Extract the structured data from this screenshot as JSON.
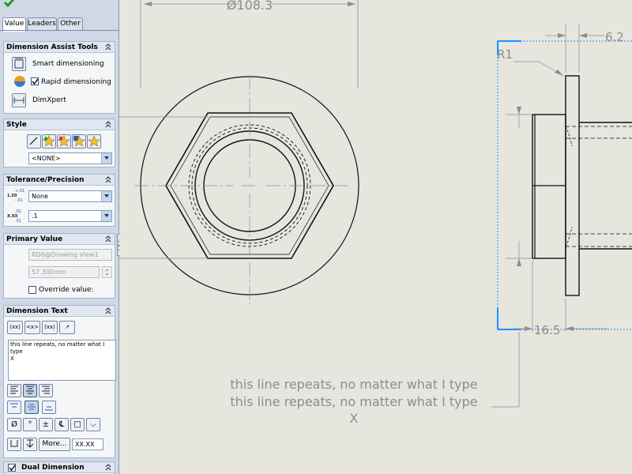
{
  "tabs": [
    {
      "label": "Value",
      "active": true
    },
    {
      "label": "Leaders",
      "active": false
    },
    {
      "label": "Other",
      "active": false
    }
  ],
  "dimension_assist": {
    "title": "Dimension Assist Tools",
    "items": [
      {
        "label": "Smart dimensioning"
      },
      {
        "label": "Rapid dimensioning",
        "checked": true
      },
      {
        "label": "DimXpert"
      }
    ]
  },
  "style": {
    "title": "Style",
    "value": "<NONE>"
  },
  "tolerance": {
    "title": "Tolerance/Precision",
    "tolerance_value": "None",
    "precision_value": ".1",
    "tol_icon_top": "1.50",
    "tol_icon_plus": "+.01",
    "tol_icon_minus": "-.01",
    "prec_icon_top": "X.XX",
    "prec_icon_small": ".01"
  },
  "primary_value": {
    "title": "Primary Value",
    "reference": "RD6@Drawing View1",
    "value": "57.300mm",
    "override_label": "Override value:"
  },
  "dimension_text": {
    "title": "Dimension Text",
    "text_lines": [
      "this line repeats, no matter what I type",
      "X"
    ],
    "more_label": "More...",
    "format_label": "XX.XX",
    "symbol_buttons": [
      "(xx)",
      "<x>",
      "(xx)",
      "↗"
    ],
    "special_symbols": [
      "Ø",
      "°",
      "±",
      "℄",
      "□",
      "⌵"
    ]
  },
  "dual_dimension": {
    "title": "Dual Dimension",
    "checked": true
  },
  "drawing": {
    "dim_diameter": "Ø108.3",
    "dim_width": "6.2",
    "dim_radius": "R1",
    "dim_length": "16.5",
    "note_lines": [
      "this line repeats, no matter what I type",
      "this line repeats, no matter what I type",
      "X"
    ]
  },
  "colors": {
    "panel_bg": "#cfd9e6",
    "canvas_bg": "#e6e6df",
    "selection_blue": "#1e90ff",
    "annotation_gray": "#8c8c8c"
  }
}
